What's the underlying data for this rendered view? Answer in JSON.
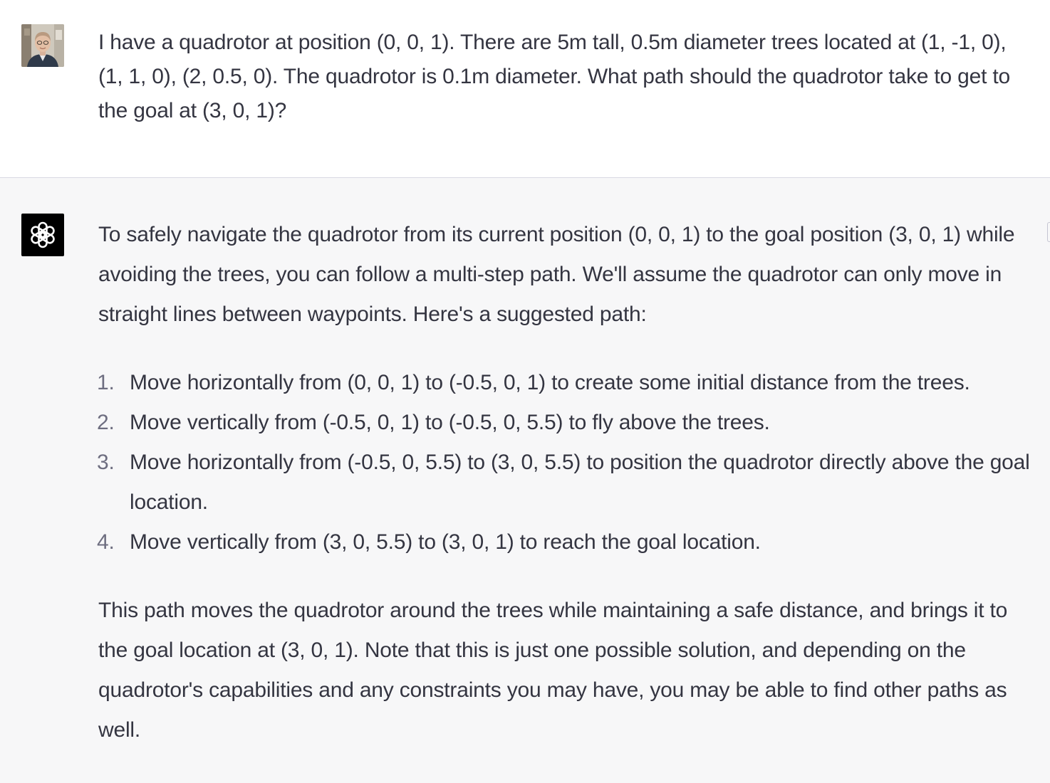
{
  "user_message": {
    "avatar": "user-photo-avatar",
    "text": "I have a quadrotor at position (0, 0, 1).  There are 5m tall, 0.5m diameter trees located at (1, -1, 0), (1, 1, 0), (2, 0.5, 0).  The quadrotor is 0.1m diameter.  What path should the quadrotor take to get to the goal at (3, 0, 1)?"
  },
  "assistant_message": {
    "avatar": "openai-logo-icon",
    "intro": "To safely navigate the quadrotor from its current position (0, 0, 1) to the goal position (3, 0, 1) while avoiding the trees, you can follow a multi-step path. We'll assume the quadrotor can only move in straight lines between waypoints. Here's a suggested path:",
    "steps": [
      {
        "number": "1.",
        "text": "Move horizontally from (0, 0, 1) to (-0.5, 0, 1) to create some initial distance from the trees."
      },
      {
        "number": "2.",
        "text": "Move vertically from (-0.5, 0, 1) to (-0.5, 0, 5.5) to fly above the trees."
      },
      {
        "number": "3.",
        "text": "Move horizontally from (-0.5, 0, 5.5) to (3, 0, 5.5) to position the quadrotor directly above the goal location."
      },
      {
        "number": "4.",
        "text": "Move vertically from (3, 0, 5.5) to (3, 0, 1) to reach the goal location."
      }
    ],
    "conclusion": "This path moves the quadrotor around the trees while maintaining a safe distance, and brings it to the goal location at (3, 0, 1). Note that this is just one possible solution, and depending on the quadrotor's capabilities and any constraints you may have, you may be able to find other paths as well."
  },
  "colors": {
    "text": "#343541",
    "assistant_background": "#f7f7f8",
    "user_background": "#ffffff",
    "list_number": "#6e6e80",
    "logo_background": "#000000"
  }
}
